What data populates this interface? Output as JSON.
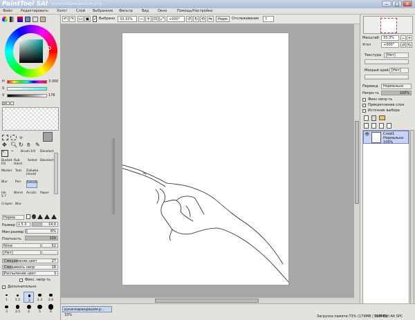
{
  "window": {
    "app_logo": "PaintTool SAI",
    "file_title": "C:\\...\\рукаскарандашом.png",
    "minimize": "–",
    "maximize": "□",
    "close": "✕"
  },
  "menu": [
    "Файл",
    "Редактировать",
    "Холст",
    "Слой",
    "Выбранное",
    "Фильтр",
    "Вид",
    "Окно",
    "Помощь/Настройки"
  ],
  "toolbar": {
    "selection_label": "Выбрано",
    "zoom": "33.33%",
    "angle": "+000°",
    "mode": "Норм",
    "stabilizer_label": "Отслаживание",
    "stabilizer_value": "7"
  },
  "color": {
    "h_label": "H",
    "h_value": "3 000",
    "s_label": "S",
    "s_value": "",
    "v_label": "V",
    "v_value": "176"
  },
  "tools": {
    "row1": [
      "Brush",
      "1/0",
      "Deselect"
    ],
    "row2": [
      "Bucket",
      "Rub",
      "Select",
      "Deselect"
    ],
    "row2b": [
      "Fill",
      "Hand",
      "",
      ""
    ],
    "row3": [
      "Marker",
      "Text",
      "Zaliwka"
    ],
    "row3b": [
      "",
      "",
      "Inhold"
    ],
    "row4": [
      "Blur",
      "Pen",
      "Details"
    ],
    "row5": [
      "Ink",
      "Blend",
      "Acrylic",
      "Paper"
    ],
    "row5b": [
      "S 7",
      "",
      "",
      ""
    ],
    "row6": [
      "Crayon",
      "Blur"
    ]
  },
  "brush": {
    "mode": "Норма",
    "size_label": "Размер",
    "size_mult": "x 5.0",
    "size_value": "14.0",
    "min_size_label": "Мин размер",
    "min_size_value": "6%",
    "density_label": "Плотность",
    "density_value": "100",
    "shape": "None",
    "shape_value": "52",
    "texture": "[Нет]",
    "mix_label": "Смешивание цвет",
    "mix_value": "27",
    "mix2_label": "Смешивать непр",
    "mix2_value": "18",
    "spread_label": "Распыление цвет",
    "spread_value": "3",
    "fix_opacity": "Фикс. непр-ть",
    "extra": "Дополнительно",
    "presets": [
      "1",
      "1.5",
      "2",
      "2.3",
      "2.6",
      "3",
      "3.5",
      "4",
      "5",
      "6",
      "7",
      "8",
      "9",
      "10",
      "12",
      "14",
      "16",
      "20",
      "25",
      "30"
    ]
  },
  "navigator": {
    "scale_label": "Масштаб",
    "scale_value": "33.3%",
    "angle_label": "Угол",
    "angle_value": "+000°"
  },
  "layer_props": {
    "texture_label": "Текстура",
    "texture_value": "[Нет]",
    "wet_edge_label": "Мокрый край",
    "wet_edge_value": "[Нет]",
    "blend_label": "Перевод",
    "blend_value": "Нормально",
    "opacity_label": "Непро-ть",
    "opacity_value": "100%",
    "check1": "Фикс непр-ть",
    "check2": "Прикрепление слоя",
    "check3": "Источник выбора"
  },
  "layers": [
    {
      "name": "Слой1",
      "mode": "Нормально",
      "opacity": "100%"
    }
  ],
  "status": {
    "tab_name": "рукаскарандашом.p...",
    "tab_zoom": "33%",
    "memory": "Загрузка памяти:73% (179MB / 798MB)",
    "keys": "Shift Ctrl Alt SPC"
  },
  "colors": {
    "accent": "#6b8ec4",
    "selected_layer": "#c9d3f5"
  }
}
